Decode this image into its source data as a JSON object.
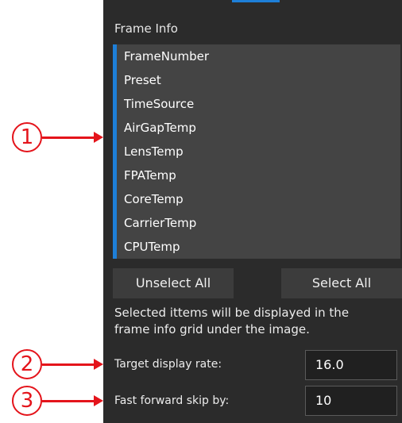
{
  "panel": {
    "section_title": "Frame Info",
    "items": [
      "FrameNumber",
      "Preset",
      "TimeSource",
      "AirGapTemp",
      "LensTemp",
      "FPATemp",
      "CoreTemp",
      "CarrierTemp",
      "CPUTemp"
    ],
    "unselect_label": "Unselect All",
    "select_label": "Select All",
    "note": "Selected ittems will be displayed in the frame info grid under the image.",
    "target_rate_label": "Target display rate:",
    "target_rate_value": "16.0",
    "skip_label": "Fast forward skip by:",
    "skip_value": "10"
  },
  "callouts": [
    "1",
    "2",
    "3"
  ],
  "colors": {
    "panel_bg": "#2b2b2b",
    "list_bg": "#444444",
    "accent": "#1e7fd8",
    "callout": "#e4141b"
  }
}
